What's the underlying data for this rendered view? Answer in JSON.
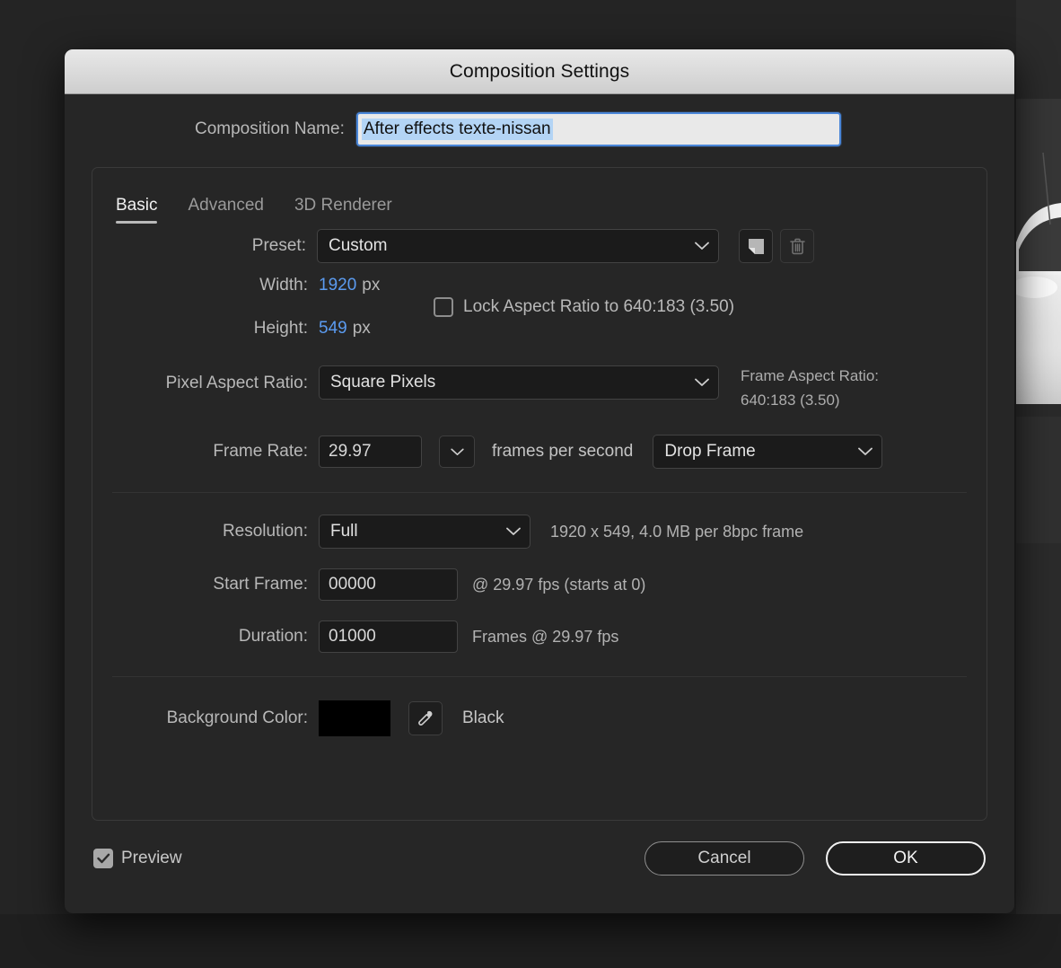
{
  "window": {
    "title": "Composition Settings"
  },
  "composition_name": {
    "label": "Composition Name:",
    "value": "After effects texte-nissan"
  },
  "tabs": [
    {
      "label": "Basic",
      "active": true
    },
    {
      "label": "Advanced",
      "active": false
    },
    {
      "label": "3D Renderer",
      "active": false
    }
  ],
  "basic": {
    "preset": {
      "label": "Preset:",
      "value": "Custom",
      "save_icon": "save-preset-icon",
      "delete_icon": "trash-icon"
    },
    "width": {
      "label": "Width:",
      "value": "1920",
      "unit": "px"
    },
    "height": {
      "label": "Height:",
      "value": "549",
      "unit": "px"
    },
    "lock_aspect": {
      "label": "Lock Aspect Ratio to 640:183 (3.50)",
      "checked": false
    },
    "pixel_aspect_ratio": {
      "label": "Pixel Aspect Ratio:",
      "value": "Square Pixels"
    },
    "frame_aspect_ratio": {
      "label": "Frame Aspect Ratio:",
      "value": "640:183 (3.50)"
    },
    "frame_rate": {
      "label": "Frame Rate:",
      "value": "29.97",
      "unit": "frames per second",
      "drop_frame": "Drop Frame"
    },
    "resolution": {
      "label": "Resolution:",
      "value": "Full",
      "info": "1920 x 549, 4.0 MB per 8bpc frame"
    },
    "start_frame": {
      "label": "Start Frame:",
      "value": "00000",
      "info": "@ 29.97 fps (starts at 0)"
    },
    "duration": {
      "label": "Duration:",
      "value": "01000",
      "info": "Frames @ 29.97 fps"
    },
    "background_color": {
      "label": "Background Color:",
      "swatch_hex": "#000000",
      "name": "Black",
      "eyedropper_icon": "eyedropper-icon"
    }
  },
  "footer": {
    "preview": {
      "label": "Preview",
      "checked": true
    },
    "cancel_label": "Cancel",
    "ok_label": "OK"
  },
  "colors": {
    "accent_blue": "#5b9bf0",
    "focus_border": "#4a86d8",
    "selection_highlight": "#b3d4f5",
    "dialog_bg": "#262626",
    "field_bg": "#1b1b1b"
  }
}
